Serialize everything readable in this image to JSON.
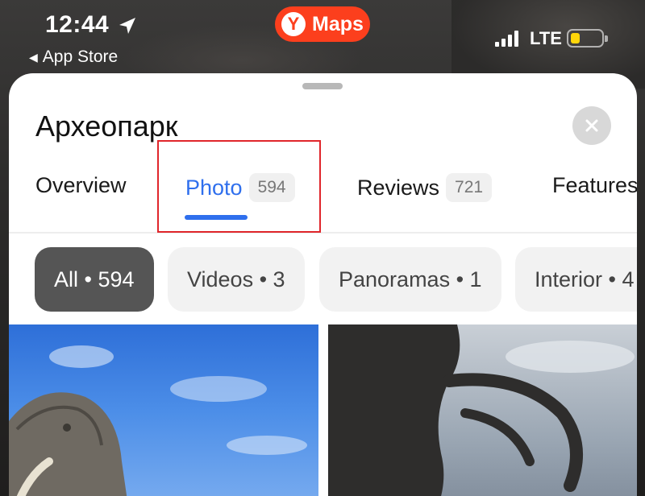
{
  "status_bar": {
    "time": "12:44",
    "back_label": "App Store",
    "network": "LTE",
    "brand_letter": "Y",
    "brand_name": "Maps"
  },
  "sheet": {
    "title": "Археопарк",
    "tabs": [
      {
        "label": "Overview",
        "count": ""
      },
      {
        "label": "Photo",
        "count": "594"
      },
      {
        "label": "Reviews",
        "count": "721"
      },
      {
        "label": "Features",
        "count": ""
      }
    ],
    "filters": [
      {
        "label": "All • 594"
      },
      {
        "label": "Videos • 3"
      },
      {
        "label": "Panoramas • 1"
      },
      {
        "label": "Interior • 4"
      }
    ]
  },
  "colors": {
    "accent": "#2f6fed",
    "brand": "#fc3f1d",
    "highlight": "#e0262b"
  },
  "icons": {
    "location": "location-arrow-icon",
    "close": "close-icon",
    "signal": "signal-icon",
    "battery": "battery-icon"
  }
}
